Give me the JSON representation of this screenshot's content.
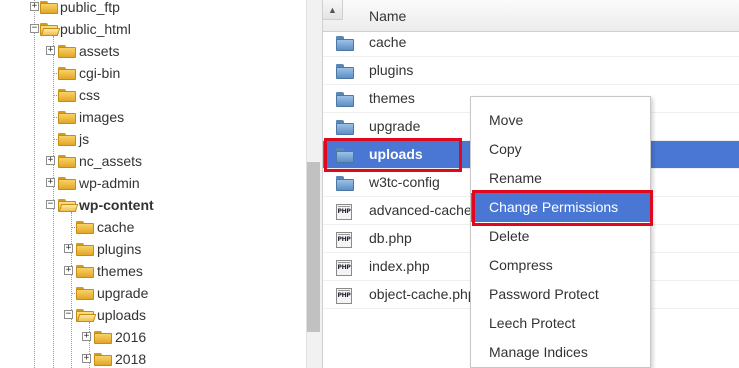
{
  "tree": {
    "items": [
      {
        "label": "public_ftp",
        "expander": "+",
        "open": false,
        "bold": false
      },
      {
        "label": "public_html",
        "expander": "−",
        "open": true,
        "bold": false
      },
      {
        "label": "assets",
        "expander": "+",
        "open": false,
        "bold": false
      },
      {
        "label": "cgi-bin",
        "expander": "",
        "open": false,
        "bold": false
      },
      {
        "label": "css",
        "expander": "",
        "open": false,
        "bold": false
      },
      {
        "label": "images",
        "expander": "",
        "open": false,
        "bold": false
      },
      {
        "label": "js",
        "expander": "",
        "open": false,
        "bold": false
      },
      {
        "label": "nc_assets",
        "expander": "+",
        "open": false,
        "bold": false
      },
      {
        "label": "wp-admin",
        "expander": "+",
        "open": false,
        "bold": false
      },
      {
        "label": "wp-content",
        "expander": "−",
        "open": true,
        "bold": true
      },
      {
        "label": "cache",
        "expander": "",
        "open": false,
        "bold": false
      },
      {
        "label": "plugins",
        "expander": "+",
        "open": false,
        "bold": false
      },
      {
        "label": "themes",
        "expander": "+",
        "open": false,
        "bold": false
      },
      {
        "label": "upgrade",
        "expander": "",
        "open": false,
        "bold": false
      },
      {
        "label": "uploads",
        "expander": "−",
        "open": true,
        "bold": false
      },
      {
        "label": "2016",
        "expander": "+",
        "open": false,
        "bold": false
      },
      {
        "label": "2018",
        "expander": "+",
        "open": false,
        "bold": false
      }
    ]
  },
  "file_list": {
    "header": {
      "name_label": "Name",
      "sort_icon": "triangle-up-icon"
    },
    "files": [
      {
        "name": "cache",
        "icon": "folder-icon",
        "selected": false
      },
      {
        "name": "plugins",
        "icon": "folder-icon",
        "selected": false
      },
      {
        "name": "themes",
        "icon": "folder-icon",
        "selected": false
      },
      {
        "name": "upgrade",
        "icon": "folder-icon",
        "selected": false
      },
      {
        "name": "uploads",
        "icon": "folder-icon",
        "selected": true
      },
      {
        "name": "w3tc-config",
        "icon": "folder-icon",
        "selected": false
      },
      {
        "name": "advanced-cache.php",
        "icon": "php-file-icon",
        "selected": false
      },
      {
        "name": "db.php",
        "icon": "php-file-icon",
        "selected": false
      },
      {
        "name": "index.php",
        "icon": "php-file-icon",
        "selected": false
      },
      {
        "name": "object-cache.php",
        "icon": "php-file-icon",
        "selected": false
      }
    ],
    "php_icon_text": "PHP"
  },
  "context_menu": {
    "items": [
      {
        "label": "Move",
        "active": false
      },
      {
        "label": "Copy",
        "active": false
      },
      {
        "label": "Rename",
        "active": false
      },
      {
        "label": "Change Permissions",
        "active": true
      },
      {
        "label": "Delete",
        "active": false
      },
      {
        "label": "Compress",
        "active": false
      },
      {
        "label": "Password Protect",
        "active": false
      },
      {
        "label": "Leech Protect",
        "active": false
      },
      {
        "label": "Manage Indices",
        "active": false
      }
    ]
  },
  "colors": {
    "selection": "#4a77d4",
    "highlight_box": "#e0081d",
    "folder_yellow": "#f0b73a",
    "folder_blue": "#6a98cc"
  }
}
